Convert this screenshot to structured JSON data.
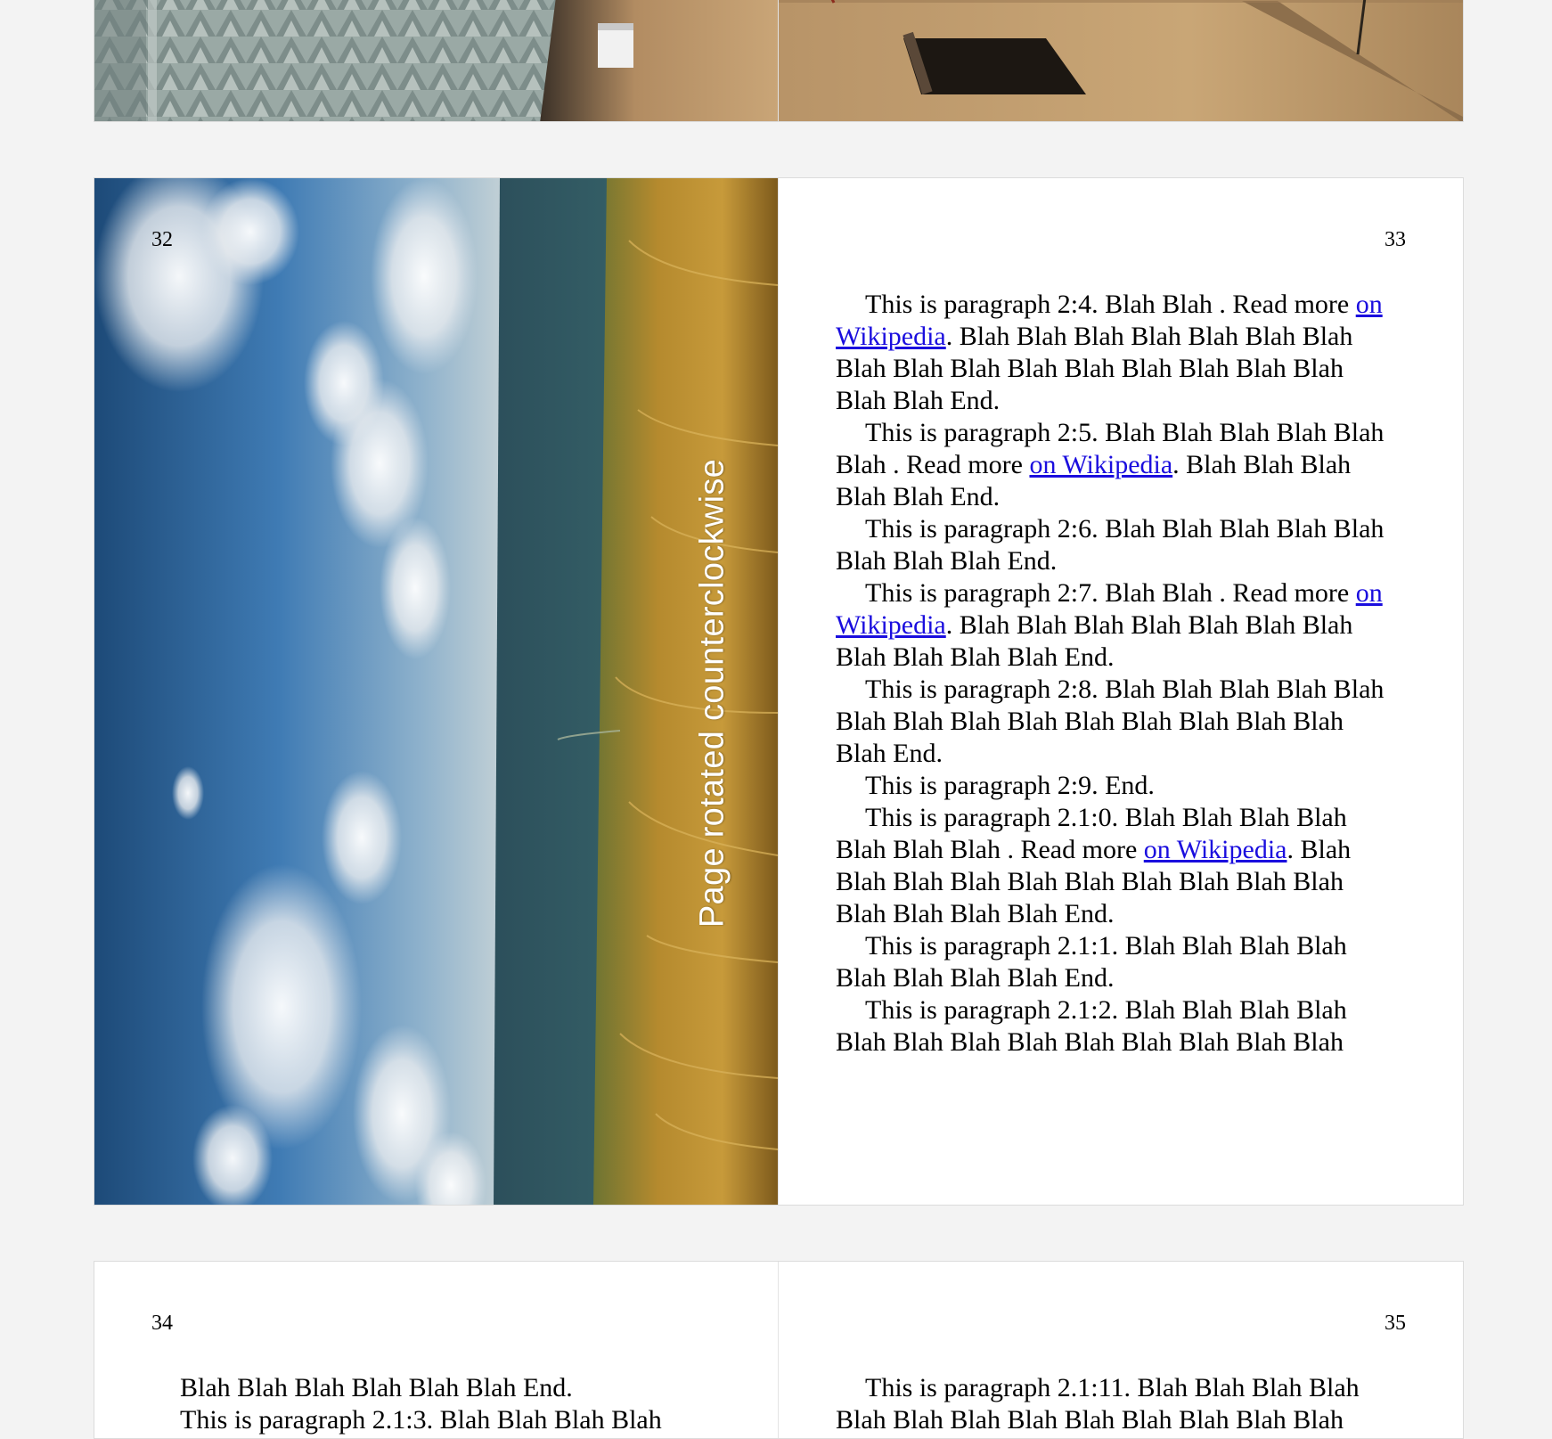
{
  "spreads": [
    {
      "left": {
        "page_number": "",
        "image": "rotated-photo-top-left"
      },
      "right": {
        "page_number": "",
        "image": "rotated-photo-top-right"
      }
    },
    {
      "left": {
        "page_number": "32",
        "image": "landscape-photo-sky-sea-grass",
        "caption": "Page rotated counterclockwise"
      },
      "right": {
        "page_number": "33",
        "paragraphs": [
          {
            "before": "This is paragraph 2:4. Blah Blah . Read more ",
            "link": "on Wikipedia",
            "after": ". Blah Blah Blah Blah Blah Blah Blah Blah Blah Blah Blah Blah Blah Blah Blah Blah Blah Blah End."
          },
          {
            "before": "This is paragraph 2:5. Blah Blah Blah Blah Blah Blah . Read more ",
            "link": "on Wikipedia",
            "after": ". Blah Blah Blah Blah Blah End."
          },
          {
            "before": "This is paragraph 2:6. Blah Blah Blah Blah Blah Blah Blah Blah End.",
            "link": "",
            "after": ""
          },
          {
            "before": "This is paragraph 2:7. Blah Blah . Read more ",
            "link": "on Wikipedia",
            "after": ". Blah Blah Blah Blah Blah Blah Blah Blah Blah Blah Blah End."
          },
          {
            "before": "This is paragraph 2:8. Blah Blah Blah Blah Blah Blah Blah Blah Blah Blah Blah Blah Blah Blah Blah End.",
            "link": "",
            "after": ""
          },
          {
            "before": "This is paragraph 2:9. End.",
            "link": "",
            "after": ""
          },
          {
            "before": "This is paragraph 2.1:0. Blah Blah Blah Blah Blah Blah Blah . Read more ",
            "link": "on Wikipedia",
            "after": ". Blah Blah Blah Blah Blah Blah Blah Blah Blah Blah Blah Blah Blah Blah End."
          },
          {
            "before": "This is paragraph 2.1:1. Blah Blah Blah Blah Blah Blah Blah Blah End.",
            "link": "",
            "after": ""
          },
          {
            "before": "This is paragraph 2.1:2. Blah Blah Blah Blah Blah Blah Blah Blah Blah Blah Blah Blah Blah",
            "link": "",
            "after": ""
          }
        ]
      }
    },
    {
      "left": {
        "page_number": "34",
        "continuation": "Blah Blah Blah Blah Blah Blah End.",
        "next_paragraph": "This is paragraph 2.1:3. Blah Blah Blah Blah"
      },
      "right": {
        "page_number": "35",
        "paragraph": "This is paragraph 2.1:11. Blah Blah Blah Blah",
        "next_line": "Blah Blah Blah Blah Blah Blah Blah Blah Blah"
      }
    }
  ],
  "colors": {
    "viewer_background": "#f3f3f3",
    "page_background": "#ffffff",
    "link": "#1a0dde",
    "caption": "#ffffff"
  }
}
